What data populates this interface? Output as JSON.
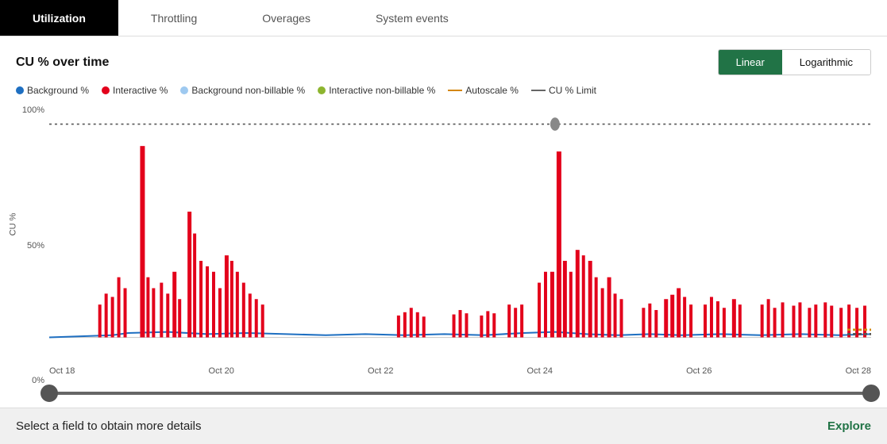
{
  "tabs": [
    {
      "label": "Utilization",
      "active": true
    },
    {
      "label": "Throttling",
      "active": false
    },
    {
      "label": "Overages",
      "active": false
    },
    {
      "label": "System events",
      "active": false
    }
  ],
  "chart": {
    "title": "CU % over time",
    "scale_linear": "Linear",
    "scale_log": "Logarithmic",
    "y_labels": [
      "100%",
      "50%",
      "0%"
    ],
    "y_axis_title": "CU %",
    "x_labels": [
      "Oct 18",
      "Oct 20",
      "Oct 22",
      "Oct 24",
      "Oct 26",
      "Oct 28"
    ],
    "legend": [
      {
        "label": "Background %",
        "color": "#1e6fc1",
        "type": "dot"
      },
      {
        "label": "Interactive %",
        "color": "#e3001b",
        "type": "dot"
      },
      {
        "label": "Background non-billable %",
        "color": "#9ec9f0",
        "type": "dot"
      },
      {
        "label": "Interactive non-billable %",
        "color": "#8db52f",
        "type": "dot"
      },
      {
        "label": "Autoscale %",
        "color": "#d4870a",
        "type": "line"
      },
      {
        "label": "CU % Limit",
        "color": "#666",
        "type": "line"
      }
    ]
  },
  "bottom": {
    "text": "Select a field to obtain more details",
    "explore": "Explore"
  }
}
